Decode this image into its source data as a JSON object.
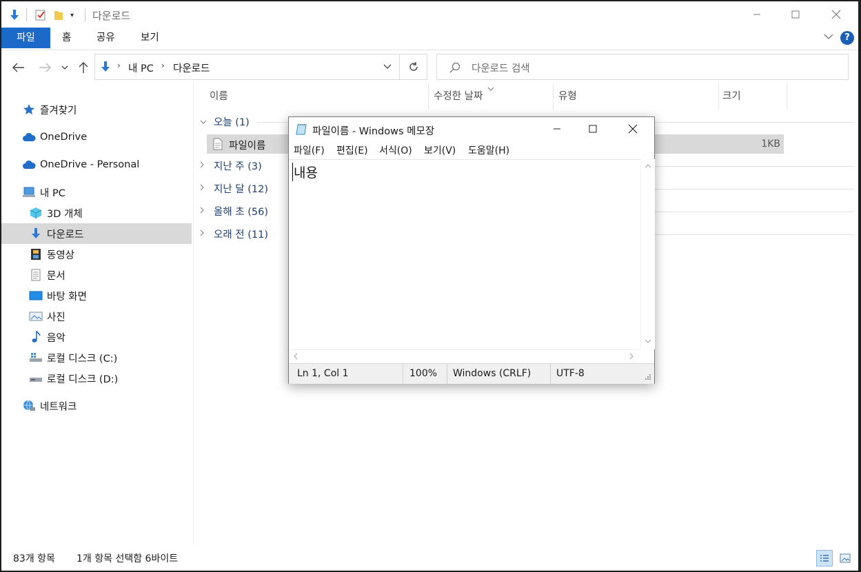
{
  "explorer": {
    "title": "다운로드",
    "ribbon_tabs": [
      "파일",
      "홈",
      "공유",
      "보기"
    ],
    "address": {
      "root": "내 PC",
      "folder": "다운로드"
    },
    "search_placeholder": "다운로드 검색",
    "nav": {
      "favorites": "즐겨찾기",
      "onedrive": "OneDrive",
      "onedrive_personal": "OneDrive - Personal",
      "this_pc": "내 PC",
      "objects3d": "3D 개체",
      "downloads": "다운로드",
      "videos": "동영상",
      "documents": "문서",
      "desktop": "바탕 화면",
      "pictures": "사진",
      "music": "음악",
      "disk_c": "로컬 디스크 (C:)",
      "disk_d": "로컬 디스크 (D:)",
      "network": "네트워크"
    },
    "columns": {
      "name": "이름",
      "modified": "수정한 날짜",
      "type": "유형",
      "size": "크기"
    },
    "groups": {
      "today": "오늘 (1)",
      "last_week": "지난 주 (3)",
      "last_month": "지난 달 (12)",
      "early_this_year": "올해 초 (56)",
      "long_ago": "오래 전 (11)"
    },
    "file": {
      "name": "파일이름",
      "size": "1KB"
    },
    "status": {
      "count": "83개 항목",
      "selected": "1개 항목 선택함 6바이트"
    }
  },
  "notepad": {
    "title": "파일이름 - Windows 메모장",
    "menu": {
      "file": "파일(F)",
      "edit": "편집(E)",
      "format": "서식(O)",
      "view": "보기(V)",
      "help": "도움말(H)"
    },
    "content": "내용",
    "status": {
      "position": "Ln 1, Col 1",
      "zoom": "100%",
      "line_ending": "Windows (CRLF)",
      "encoding": "UTF-8"
    }
  },
  "colors": {
    "accent": "#1b6ac9",
    "selection": "#d9d9d9",
    "help": "#1a5fb4"
  }
}
